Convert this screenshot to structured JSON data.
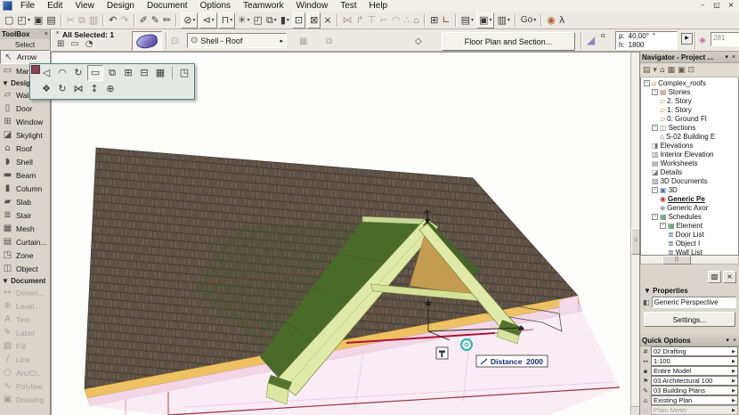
{
  "window": {
    "controls": [
      {
        "name": "minimize-button",
        "glyph": "–"
      },
      {
        "name": "restore-button",
        "glyph": "◱"
      },
      {
        "name": "close-button",
        "glyph": "×"
      }
    ]
  },
  "menu": {
    "items": [
      "File",
      "Edit",
      "View",
      "Design",
      "Document",
      "Options",
      "Teamwork",
      "Window",
      "Test",
      "Help"
    ]
  },
  "toolbar": {
    "items": [
      {
        "name": "new-icon",
        "glyph": "▢"
      },
      {
        "name": "open-icon",
        "glyph": "◰",
        "dd": true
      },
      {
        "name": "save-icon",
        "glyph": "▣"
      },
      {
        "name": "print-icon",
        "glyph": "▤"
      },
      {
        "name": "cut-icon",
        "glyph": "✂",
        "disabled": true,
        "sep": true
      },
      {
        "name": "copy-icon",
        "glyph": "⧉",
        "disabled": true
      },
      {
        "name": "paste-icon",
        "glyph": "▥",
        "disabled": true
      },
      {
        "name": "undo-icon",
        "glyph": "↶",
        "sep": true
      },
      {
        "name": "redo-icon",
        "glyph": "↷",
        "disabled": true
      },
      {
        "name": "pickup-parameters-icon",
        "glyph": "✐",
        "sep": true
      },
      {
        "name": "inject-parameters-icon",
        "glyph": "✎"
      },
      {
        "name": "wall-pen-icon",
        "glyph": "✏"
      },
      {
        "name": "selection-visibility-icon",
        "glyph": "⊘",
        "boxed": true,
        "dd": true,
        "sep": true
      },
      {
        "name": "plane-cut-icon",
        "glyph": "⊲",
        "boxed": true,
        "dd": true
      },
      {
        "name": "3d-cutaway-icon",
        "glyph": "⊓",
        "boxed": true,
        "dd": true
      },
      {
        "name": "suspend-groups-icon",
        "glyph": "✳",
        "dd": true
      },
      {
        "name": "corner-window-icon",
        "glyph": "◰"
      },
      {
        "name": "layers-icon",
        "glyph": "⧉",
        "dd": true
      },
      {
        "name": "column-display-icon",
        "glyph": "▮",
        "dd": true
      },
      {
        "name": "select-area-icon",
        "glyph": "⊡",
        "boxed": true
      },
      {
        "name": "grid-snap-icon",
        "glyph": "⊠",
        "boxed": true
      },
      {
        "name": "close-view-icon",
        "glyph": "×"
      },
      {
        "name": "mirror-icon",
        "glyph": "⋈",
        "disabled": true,
        "sep": true
      },
      {
        "name": "rotate-icon",
        "glyph": "↱",
        "disabled": true
      },
      {
        "name": "multiply-icon",
        "glyph": "⊤",
        "disabled": true
      },
      {
        "name": "fillet-icon",
        "glyph": "⌐",
        "disabled": true
      },
      {
        "name": "arc-icon",
        "glyph": "◠",
        "disabled": true
      },
      {
        "name": "resize-icon",
        "glyph": "∴",
        "disabled": true
      },
      {
        "name": "home-story-icon",
        "glyph": "⌂",
        "disabled": true
      },
      {
        "name": "element-settings-icon",
        "glyph": "⊞",
        "sep": true
      },
      {
        "name": "trace-reference-icon",
        "glyph": "∟",
        "color": "#9c2a2a"
      },
      {
        "name": "new-layout-icon",
        "glyph": "▤",
        "dd": true,
        "sep": true
      },
      {
        "name": "3d-window-icon",
        "glyph": "▣",
        "boxed": true,
        "dd": true
      },
      {
        "name": "fly-through-icon",
        "glyph": "▥",
        "dd": true
      },
      {
        "name": "go-dropdown",
        "glyph": "Go",
        "text": true,
        "dd": true,
        "sep": true
      },
      {
        "name": "quick-views-icon",
        "glyph": "◉",
        "color": "#b06030",
        "sep": true
      },
      {
        "name": "walk-mode-icon",
        "glyph": "λ"
      }
    ]
  },
  "infobox": {
    "close_glyph": "×",
    "header": "All Selected: 1",
    "geometry_icons": [
      {
        "name": "geometry-method-icon",
        "glyph": "⊞"
      },
      {
        "name": "construction-method-icon",
        "glyph": "▭"
      },
      {
        "name": "rotate-method-icon",
        "glyph": "◔"
      }
    ],
    "extra_icons": [
      {
        "glyph": "⊡"
      },
      {
        "glyph": "▦"
      },
      {
        "glyph": "⧉"
      },
      {
        "glyph": "◇"
      }
    ],
    "element_visibility": {
      "glyph": "⊙",
      "label": "Shell - Roof",
      "arrow": "▸"
    },
    "floor_plan_button": "Floor Plan and Section...",
    "pitch": {
      "icon_glyph": "◢",
      "alpha": "α:",
      "p_label": "p:",
      "p_value": "40,00°",
      "unit": "°",
      "h_label": "h:",
      "h_value": "1800",
      "flyout": "▶"
    },
    "id_icon_glyph": "◈",
    "id_field": "281"
  },
  "toolbox": {
    "title": "ToolBox",
    "close_glyph": "×",
    "sections": [
      {
        "label": "Select",
        "plain": true,
        "items": [
          {
            "label": "Arrow",
            "glyph": "↖",
            "icon": "arrow-tool-icon",
            "selected": true
          },
          {
            "label": "Marquee",
            "glyph": "▭",
            "icon": "marquee-tool-icon"
          }
        ]
      },
      {
        "label": "Design",
        "items": [
          {
            "label": "Wall",
            "glyph": "▱",
            "icon": "wall-tool-icon"
          },
          {
            "label": "Door",
            "glyph": "▯",
            "icon": "door-tool-icon"
          },
          {
            "label": "Window",
            "glyph": "⊞",
            "icon": "window-tool-icon"
          },
          {
            "label": "Skylight",
            "glyph": "◪",
            "icon": "skylight-tool-icon"
          },
          {
            "label": "Roof",
            "glyph": "⌂",
            "icon": "roof-tool-icon"
          },
          {
            "label": "Shell",
            "glyph": "◗",
            "icon": "shell-tool-icon"
          },
          {
            "label": "Beam",
            "glyph": "▬",
            "icon": "beam-tool-icon"
          },
          {
            "label": "Column",
            "glyph": "▮",
            "icon": "column-tool-icon"
          },
          {
            "label": "Slab",
            "glyph": "▰",
            "icon": "slab-tool-icon"
          },
          {
            "label": "Stair",
            "glyph": "≣",
            "icon": "stair-tool-icon"
          },
          {
            "label": "Mesh",
            "glyph": "▦",
            "icon": "mesh-tool-icon"
          },
          {
            "label": "Curtain...",
            "glyph": "▤",
            "icon": "curtain-wall-tool-icon"
          },
          {
            "label": "Zone",
            "glyph": "◳",
            "icon": "zone-tool-icon"
          },
          {
            "label": "Object",
            "glyph": "◫",
            "icon": "object-tool-icon"
          }
        ]
      },
      {
        "label": "Document",
        "disabled": true,
        "items": [
          {
            "label": "Dimen...",
            "glyph": "↔",
            "icon": "dimension-tool-icon"
          },
          {
            "label": "Level ...",
            "glyph": "⊕",
            "icon": "level-dimension-tool-icon"
          },
          {
            "label": "Text",
            "glyph": "A",
            "icon": "text-tool-icon"
          },
          {
            "label": "Label",
            "glyph": "✎",
            "icon": "label-tool-icon"
          },
          {
            "label": "Fill",
            "glyph": "▨",
            "icon": "fill-tool-icon"
          },
          {
            "label": "Line",
            "glyph": "∕",
            "icon": "line-tool-icon"
          },
          {
            "label": "Arc/Ci...",
            "glyph": "○",
            "icon": "arc-circle-tool-icon"
          },
          {
            "label": "Polyline",
            "glyph": "∿",
            "icon": "polyline-tool-icon"
          },
          {
            "label": "Drawing",
            "glyph": "▣",
            "icon": "drawing-tool-icon"
          }
        ]
      }
    ]
  },
  "pet_palette": {
    "rows": [
      [
        {
          "name": "move-node-icon",
          "glyph": "◁"
        },
        {
          "name": "curve-edge-icon",
          "glyph": "◠"
        },
        {
          "name": "rotate-edge-icon",
          "glyph": "↻"
        },
        {
          "name": "offset-edge-icon",
          "glyph": "▭",
          "selected": true
        },
        {
          "name": "offset-all-edges-icon",
          "glyph": "⧉"
        },
        {
          "name": "add-to-polygon-icon",
          "glyph": "⊞"
        },
        {
          "name": "subtract-from-polygon-icon",
          "glyph": "⊟"
        },
        {
          "name": "stretch-icon",
          "glyph": "▦"
        },
        {
          "name": "flyout-corner-icon",
          "glyph": "◳",
          "sep": true
        }
      ],
      [
        {
          "name": "drag-icon",
          "glyph": "❖"
        },
        {
          "name": "rotate-free-icon",
          "glyph": "↻"
        },
        {
          "name": "mirror-free-icon",
          "glyph": "⋈"
        },
        {
          "name": "elevate-icon",
          "glyph": "↕"
        },
        {
          "name": "multiply-free-icon",
          "glyph": "⊕"
        }
      ]
    ]
  },
  "viewport": {
    "tooltip_label": "Distance",
    "tooltip_value": "2000"
  },
  "navigator": {
    "title": "Navigator - Project ...",
    "collapse_glyph": "▾",
    "close_glyph": "×",
    "header_icons": [
      {
        "name": "project-chooser-icon",
        "glyph": "▤",
        "dd": true
      },
      {
        "name": "project-map-icon",
        "glyph": "⌂"
      },
      {
        "name": "view-map-icon",
        "glyph": "▦"
      },
      {
        "name": "layout-book-icon",
        "glyph": "▣"
      },
      {
        "name": "publisher-icon",
        "glyph": "⊡"
      }
    ],
    "tree": [
      {
        "depth": 0,
        "label": "Complex_roofs",
        "glyph": "⌂",
        "icon": "project-icon",
        "color": "#d4882a",
        "expand": true
      },
      {
        "depth": 1,
        "label": "Stories",
        "glyph": "▤",
        "icon": "stories-icon",
        "color": "#9a7a4a",
        "expand": true
      },
      {
        "depth": 2,
        "label": "2. Story",
        "glyph": "▱",
        "icon": "story-icon",
        "color": "#d4882a"
      },
      {
        "depth": 2,
        "label": "1. Story",
        "glyph": "▱",
        "icon": "story-icon",
        "color": "#d4882a"
      },
      {
        "depth": 2,
        "label": "0. Ground Fl",
        "glyph": "▱",
        "icon": "story-icon",
        "color": "#d4882a"
      },
      {
        "depth": 1,
        "label": "Sections",
        "glyph": "◫",
        "icon": "sections-icon",
        "color": "#777777",
        "expand": true
      },
      {
        "depth": 2,
        "label": "S-02 Building E",
        "glyph": "⌂",
        "icon": "section-item-icon",
        "color": "#999999"
      },
      {
        "depth": 1,
        "label": "Elevations",
        "glyph": "◨",
        "icon": "elevations-icon",
        "color": "#777777"
      },
      {
        "depth": 1,
        "label": "Interior Elevation",
        "glyph": "▥",
        "icon": "interior-elevations-icon",
        "color": "#777777"
      },
      {
        "depth": 1,
        "label": "Worksheets",
        "glyph": "▤",
        "icon": "worksheets-icon",
        "color": "#777777"
      },
      {
        "depth": 1,
        "label": "Details",
        "glyph": "◪",
        "icon": "details-icon",
        "color": "#777777"
      },
      {
        "depth": 1,
        "label": "3D Documents",
        "glyph": "▧",
        "icon": "3d-documents-icon",
        "color": "#777777"
      },
      {
        "depth": 1,
        "label": "3D",
        "glyph": "▣",
        "icon": "3d-icon",
        "color": "#5577aa",
        "expand": true
      },
      {
        "depth": 2,
        "label": "Generic Pe",
        "glyph": "◉",
        "icon": "perspective-icon",
        "color": "#aa4433",
        "bold": true,
        "selected": true
      },
      {
        "depth": 2,
        "label": "Generic Axor",
        "glyph": "◈",
        "icon": "axonometry-icon",
        "color": "#888888"
      },
      {
        "depth": 1,
        "label": "Schedules",
        "glyph": "▦",
        "icon": "schedules-icon",
        "color": "#3a8a4a",
        "expand": true
      },
      {
        "depth": 2,
        "label": "Element",
        "glyph": "▦",
        "icon": "element-schedule-icon",
        "color": "#3a8a4a",
        "expand": true
      },
      {
        "depth": 3,
        "label": "Door List",
        "glyph": "≣",
        "icon": "list-icon",
        "color": "#556677"
      },
      {
        "depth": 3,
        "label": "Object I",
        "glyph": "≣",
        "icon": "list-icon",
        "color": "#556677"
      },
      {
        "depth": 3,
        "label": "Wall List",
        "glyph": "≣",
        "icon": "list-icon",
        "color": "#556677"
      }
    ]
  },
  "properties": {
    "buttons": [
      {
        "name": "palette-dock-button",
        "glyph": "▨"
      },
      {
        "name": "close-properties-button",
        "glyph": "×"
      }
    ],
    "collapse_glyph": "▼",
    "label": "Properties",
    "field_icon_glyph": "◧",
    "value": "Generic Perspective",
    "settings_button": "Settings..."
  },
  "quick_options": {
    "title": "Quick Options",
    "collapse_glyph": "▾",
    "close_glyph": "×",
    "rows": [
      {
        "name": "layer-combination",
        "icon_glyph": "#",
        "value": "02 Drafting"
      },
      {
        "name": "scale",
        "icon_glyph": "↔",
        "value": "1:100"
      },
      {
        "name": "structure-display",
        "icon_glyph": "▪",
        "value": "Entire Model"
      },
      {
        "name": "pen-set",
        "icon_glyph": "⚑",
        "value": "03 Architectural 100"
      },
      {
        "name": "model-view-options",
        "icon_glyph": "✎",
        "value": "03 Building Plans"
      },
      {
        "name": "renovation-filter",
        "icon_glyph": "⌂",
        "value": "Existing Plan"
      },
      {
        "name": "dimension-style",
        "icon_glyph": "▫",
        "value": "Plain Meter",
        "disabled": true
      }
    ]
  },
  "scene": {
    "colors": {
      "roof_brown": "#5d5145",
      "roof_line": "#463d33",
      "fascia_yellow": "#eec263",
      "gable_dark_green": "#4a6a2a",
      "gable_light_green": "#e0eaa8",
      "gable_edge_green": "#75883c",
      "underside_tan": "#c39b51",
      "wall_pink": "#f2d6e6",
      "floor_pink": "#f9ecf5",
      "outline_red": "#a83535",
      "eave_crimson": "#b01335",
      "snap_teal": "#2fb3a3"
    }
  }
}
